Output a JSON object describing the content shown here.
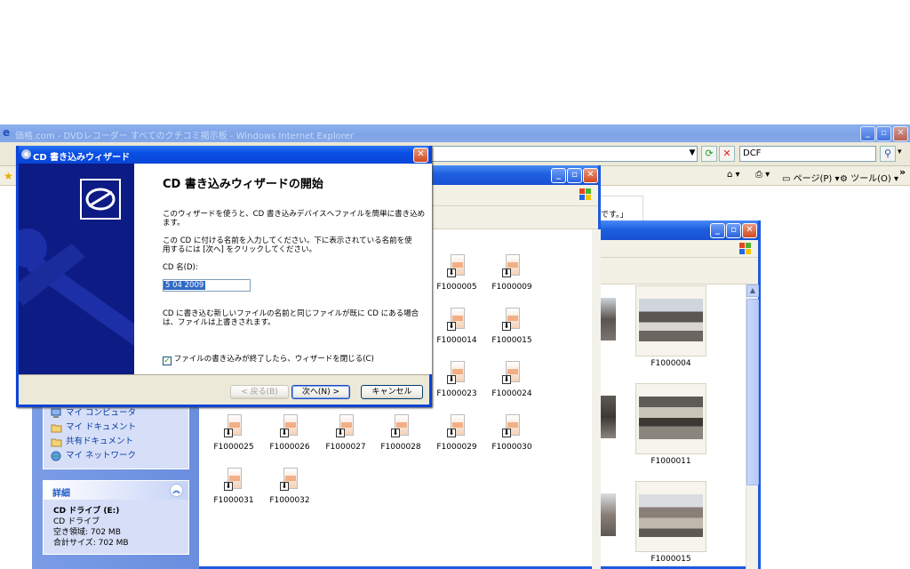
{
  "ie": {
    "title": "価格.com - DVDレコーダー すべてのクチコミ掲示板 - Windows Internet Explorer",
    "search_value": "DCF",
    "cmd_page": "ページ(P)",
    "cmd_tools": "ツール(O)",
    "cmd_more": "»",
    "content_fragment": "です。」"
  },
  "task_pane": {
    "links": [
      {
        "label": "マイ コンピュータ",
        "icon": "my-computer-icon"
      },
      {
        "label": "マイ ドキュメント",
        "icon": "my-documents-icon"
      },
      {
        "label": "共有ドキュメント",
        "icon": "shared-folder-icon"
      },
      {
        "label": "マイ ネットワーク",
        "icon": "network-icon"
      }
    ],
    "details_header": "詳細",
    "drive_name": "CD ドライブ (E:)",
    "drive_type": "CD ドライブ",
    "free_space": "空き領域: 702 MB",
    "total_size": "合計サイズ: 702 MB"
  },
  "files": [
    "F1000005",
    "F1000009",
    "F1000014",
    "F1000015",
    "F1000023",
    "F1000024",
    "F1000025",
    "F1000026",
    "F1000027",
    "F1000028",
    "F1000029",
    "F1000030",
    "F1000031",
    "F1000032"
  ],
  "thumbs": [
    "F1000004",
    "F1000011",
    "F1000015"
  ],
  "wizard": {
    "title": "CD 書き込みウィザード",
    "heading": "CD 書き込みウィザードの開始",
    "intro_line1": "このウィザードを使うと、CD 書き込みデバイスへファイルを簡単に書き込め",
    "intro_line2": "ます。",
    "name_line1": "この CD に付ける名前を入力してください。下に表示されている名前を使",
    "name_line2": "用するには [次へ] をクリックしてください。",
    "cd_name_label": "CD 名(D):",
    "cd_name_value": "5 04 2009",
    "overwrite_line1": "CD に書き込む新しいファイルの名前と同じファイルが既に CD にある場合",
    "overwrite_line2": "は、ファイルは上書きされます。",
    "checkbox_label": "ファイルの書き込みが終了したら、ウィザードを閉じる(C)",
    "checkbox_checked": true,
    "back_label": "< 戻る(B)",
    "next_label": "次へ(N) >",
    "cancel_label": "キャンセル"
  }
}
